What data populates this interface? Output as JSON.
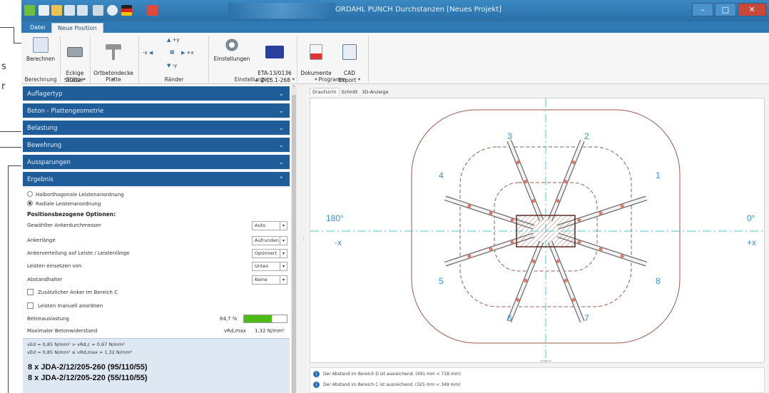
{
  "app": {
    "title": "ORDAHL PUNCH  Durchstanzen  [Neues Projekt]",
    "tabs": [
      "Datei",
      "Neue Position"
    ],
    "window_controls": [
      "–",
      "□",
      "✕"
    ]
  },
  "ribbon": {
    "buttons": [
      {
        "label": "Berechnen",
        "icon": "calculator-icon"
      },
      {
        "label": "Eckige\nStütze *",
        "icon": "rectangle-column-icon"
      },
      {
        "label": "Ortbetondecke\n*",
        "icon": "t-beam-icon"
      },
      {
        "label": "Einstellungen",
        "icon": "gear-icon"
      },
      {
        "label": "ETA-13/0136\n+ Z-15.1-268 *",
        "icon": "eu-flag-icon"
      },
      {
        "label": "Dokumente\n*",
        "icon": "pdf-document-icon"
      },
      {
        "label": "CAD\nExport *",
        "icon": "cad-export-icon"
      }
    ],
    "edge_controls": {
      "minus_x": "-x",
      "plus_x": "+x",
      "plus_y": "+y",
      "minus_y": "-y"
    },
    "groups": [
      "Berechnung",
      "Stütze",
      "Platte",
      "Ränder",
      "Einstellungen",
      "Programm"
    ]
  },
  "panel": {
    "sections": [
      "Auflagertyp",
      "Beton - Plattengeometrie",
      "Belastung",
      "Bewehrung",
      "Aussparungen",
      "Ergebnis"
    ],
    "radio_options": [
      {
        "label": "Halborthogonale Leistenanordnung",
        "selected": false
      },
      {
        "label": "Radiale Leistenanordnung",
        "selected": true
      }
    ],
    "options_heading": "Positionsbezogene Optionen:",
    "dropdowns": [
      {
        "label": "Gewählter Ankerdurchmesser",
        "value": "Auto"
      },
      {
        "label": "Ankerlänge",
        "value": "Aufrunden"
      },
      {
        "label": "Ankerverteilung auf Leiste / Leistenlänge",
        "value": "Optimiert"
      },
      {
        "label": "Leisten einsetzen von",
        "value": "Unten"
      },
      {
        "label": "Abstandhalter",
        "value": "Keine"
      }
    ],
    "checkboxes": [
      {
        "label": "Zusätzlicher Anker im Bereich C",
        "checked": false
      },
      {
        "label": "Leisten manuell anordnen",
        "checked": false
      }
    ],
    "concrete_utilization": {
      "label": "Betonauslastung",
      "value_text": "64,7 %",
      "fraction": 0.647,
      "color": "#4cbb17"
    },
    "max_concrete_resistance": {
      "label": "Maximaler Betonwiderstand",
      "symbol": "vRd,max",
      "value": "1.32 N/mm²"
    },
    "checks": [
      "vEd = 0,85 N/mm² > vRd,c = 0,67 N/mm²",
      "vEd = 0,85 N/mm² ≤ vRd,max = 1,32 N/mm²"
    ],
    "results": [
      "8 x JDA-2/12/205-260 (95/110/55)",
      "8 x JDA-2/12/205-220 (55/110/55)"
    ]
  },
  "view": {
    "tabs": [
      "Draufsicht",
      "Schnitt",
      "3D-Anzeige"
    ],
    "angle_left": "180°",
    "angle_right": "0°",
    "axis_left": "-x",
    "axis_right": "+x",
    "rail_numbers": [
      "1",
      "2",
      "3",
      "4",
      "5",
      "6",
      "7",
      "8"
    ],
    "messages": [
      "Der Abstand im Bereich D ist ausreichend. (491 mm < 718 mm)",
      "Der Abstand im Bereich C ist ausreichend. (325 mm < 349 mm)"
    ]
  },
  "document_margin": {
    "fragments": [
      "s",
      "r"
    ]
  },
  "colors": {
    "accent": "#1f5c9a",
    "titlebar": "#2f79b5",
    "outline": "#a0584e",
    "axis": "#4cc6cf",
    "label": "#3a8fd1"
  }
}
